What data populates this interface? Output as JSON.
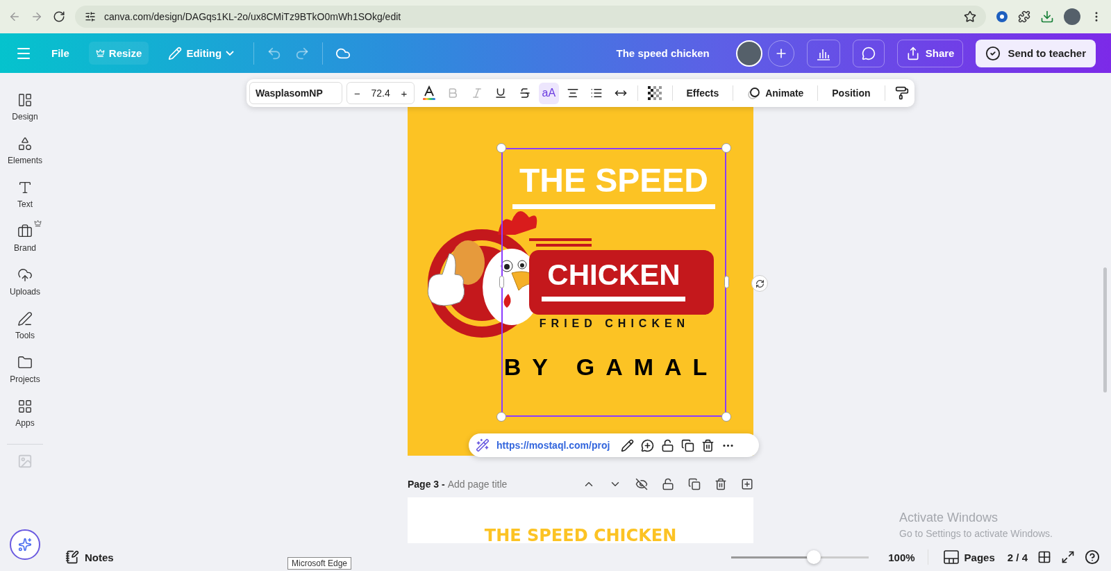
{
  "browser": {
    "url": "canva.com/design/DAGqs1KL-2o/ux8CMiTz9BTkO0mWh1SOkg/edit",
    "tooltip": "Microsoft Edge"
  },
  "header": {
    "file": "File",
    "resize": "Resize",
    "mode": "Editing",
    "title": "The speed chicken",
    "share": "Share",
    "send": "Send to teacher"
  },
  "sidebar": {
    "items": [
      {
        "label": "Design",
        "premium": false
      },
      {
        "label": "Elements",
        "premium": false
      },
      {
        "label": "Text",
        "premium": false
      },
      {
        "label": "Brand",
        "premium": true
      },
      {
        "label": "Uploads",
        "premium": false
      },
      {
        "label": "Tools",
        "premium": false
      },
      {
        "label": "Projects",
        "premium": false
      },
      {
        "label": "Apps",
        "premium": false
      }
    ]
  },
  "text_toolbar": {
    "font": "WasplasomNP",
    "size": "72.4",
    "size_minus": "−",
    "size_plus": "+",
    "bold": {
      "disabled": true
    },
    "italic": {
      "disabled": true
    },
    "case": {
      "label": "aA",
      "selected": true
    },
    "effects": "Effects",
    "animate": "Animate",
    "position": "Position"
  },
  "design": {
    "heading": "THE SPEED",
    "banner": "CHICKEN",
    "tagline": "FRIED CHICKEN",
    "byline": "BY GAMAL"
  },
  "link_bar": {
    "url": "https://mostaql.com/proj"
  },
  "page3": {
    "label": "Page 3 -",
    "placeholder": "Add page title",
    "preview_text": "THE SPEED CHICKEN"
  },
  "footer": {
    "notes": "Notes",
    "zoom": {
      "level": 0.6
    },
    "zoom_reading": "100%",
    "pages": "Pages",
    "page_count": "2 / 4"
  },
  "windows_notice": {
    "title": "Activate Windows",
    "text": "Go to Settings to activate Windows."
  }
}
